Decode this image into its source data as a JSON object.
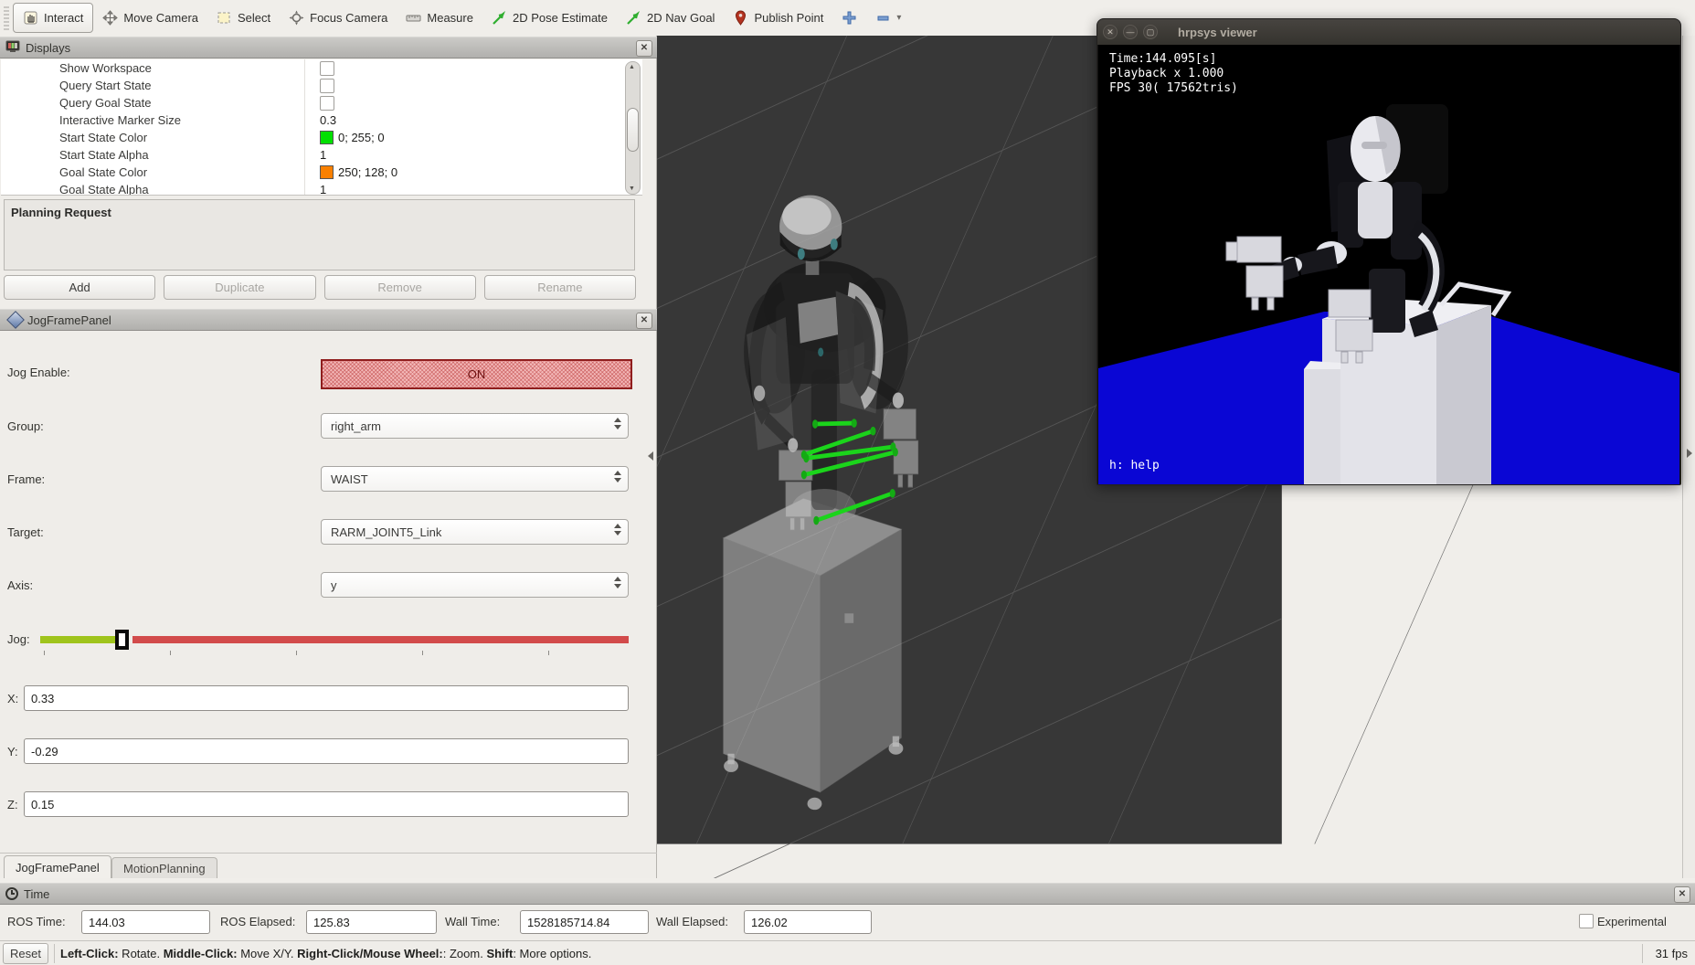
{
  "toolbar": {
    "tools": [
      {
        "label": "Interact"
      },
      {
        "label": "Move Camera"
      },
      {
        "label": "Select"
      },
      {
        "label": "Focus Camera"
      },
      {
        "label": "Measure"
      },
      {
        "label": "2D Pose Estimate"
      },
      {
        "label": "2D Nav Goal"
      },
      {
        "label": "Publish Point"
      }
    ]
  },
  "displays_panel": {
    "title": "Displays",
    "properties": [
      {
        "label": "Show Workspace",
        "type": "checkbox",
        "checked": false
      },
      {
        "label": "Query Start State",
        "type": "checkbox",
        "checked": false
      },
      {
        "label": "Query Goal State",
        "type": "checkbox",
        "checked": false
      },
      {
        "label": "Interactive Marker Size",
        "value": "0.3"
      },
      {
        "label": "Start State Color",
        "value": "0; 255; 0",
        "swatch": "#00e000"
      },
      {
        "label": "Start State Alpha",
        "value": "1"
      },
      {
        "label": "Goal State Color",
        "value": "250; 128; 0",
        "swatch": "#fa8000"
      },
      {
        "label": "Goal State Alpha",
        "value": "1"
      }
    ]
  },
  "planning_request": {
    "title": "Planning Request",
    "buttons": [
      {
        "label": "Add",
        "enabled": true
      },
      {
        "label": "Duplicate",
        "enabled": false
      },
      {
        "label": "Remove",
        "enabled": false
      },
      {
        "label": "Rename",
        "enabled": false
      }
    ]
  },
  "jog_frame_panel": {
    "title": "JogFramePanel",
    "jog_enable_label": "Jog Enable:",
    "on_label": "ON",
    "fields": [
      {
        "label": "Group:",
        "value": "right_arm"
      },
      {
        "label": "Frame:",
        "value": "WAIST"
      },
      {
        "label": "Target:",
        "value": "RARM_JOINT5_Link"
      },
      {
        "label": "Axis:",
        "value": "y"
      }
    ],
    "jog_label": "Jog:",
    "jog_position_pct": 14,
    "xyz": [
      {
        "label": "X:",
        "value": "0.33"
      },
      {
        "label": "Y:",
        "value": "-0.29"
      },
      {
        "label": "Z:",
        "value": "0.15"
      }
    ]
  },
  "tabs": [
    {
      "label": "JogFramePanel",
      "active": true
    },
    {
      "label": "MotionPlanning",
      "active": false
    }
  ],
  "time_panel": {
    "title": "Time",
    "fields": [
      {
        "label": "ROS Time:",
        "value": "144.03"
      },
      {
        "label": "ROS Elapsed:",
        "value": "125.83"
      },
      {
        "label": "Wall Time:",
        "value": "1528185714.84"
      },
      {
        "label": "Wall Elapsed:",
        "value": "126.02"
      }
    ],
    "experimental_label": "Experimental"
  },
  "status_bar": {
    "reset_label": "Reset",
    "segments": [
      {
        "t": "Left-Click:"
      },
      {
        "t": " Rotate. "
      },
      {
        "t": "Middle-Click:"
      },
      {
        "t": " Move X/Y. "
      },
      {
        "t": "Right-Click/Mouse Wheel:"
      },
      {
        "t": ": Zoom. "
      },
      {
        "t": "Shift"
      },
      {
        "t": ": More options."
      }
    ],
    "fps": "31 fps"
  },
  "hrpsys_viewer": {
    "title": "hrpsys viewer",
    "hud_lines": [
      "Time:144.095[s]",
      "Playback x 1.000",
      "FPS 30( 17562tris)"
    ],
    "help_text": "h: help"
  },
  "icons": {
    "close": "✕",
    "window_close": "✕",
    "window_minimize": "—",
    "window_maximize": "▢",
    "dropdown": "▾",
    "scroll_up": "▲",
    "scroll_down": "▼"
  },
  "colors": {
    "start_state_color": "#00e000",
    "goal_state_color": "#fa8000",
    "on_button_red": "#8f1d1d",
    "slider_green": "#9fc41c",
    "slider_red": "#d24b4b",
    "trajectory_green": "#1bd41b",
    "floor_blue": "#0a06d4",
    "view_background": "#373737"
  }
}
